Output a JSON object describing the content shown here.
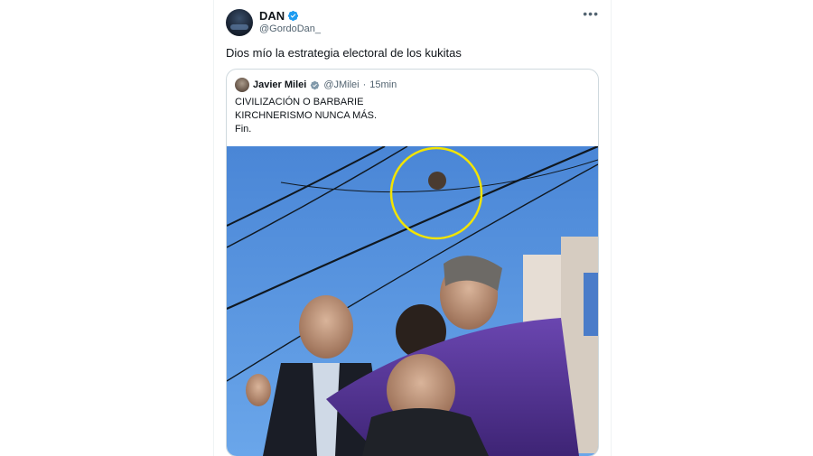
{
  "tweet": {
    "display_name": "DAN",
    "handle": "@GordoDan_",
    "text": "Dios mío la estrategia electoral de los kukitas",
    "more_icon": "more-horizontal-icon"
  },
  "quote": {
    "display_name": "Javier Milei",
    "handle": "@JMilei",
    "separator": "·",
    "time": "15min",
    "lines": [
      "CIVILIZACIÓN O BARBARIE",
      "KIRCHNERISMO NUNCA MÁS.",
      "Fin."
    ]
  },
  "colors": {
    "verified": "#1d9bf0",
    "text": "#0f1419",
    "secondary": "#536471",
    "border": "#cfd9de",
    "highlight_circle": "#f2e400"
  }
}
